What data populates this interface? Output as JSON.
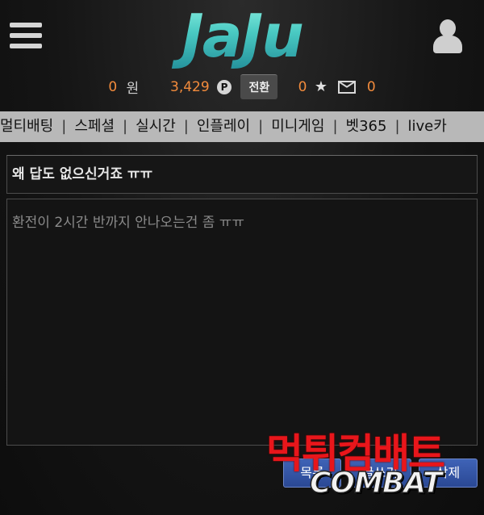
{
  "header": {
    "logo_text": "JaJu",
    "menu_icon": "hamburger-icon",
    "user_icon": "user-icon"
  },
  "balance": {
    "money": "0",
    "money_unit": "원",
    "points": "3,429",
    "points_badge": "P",
    "convert_label": "전환",
    "stars": "0",
    "star_glyph": "★",
    "messages": "0"
  },
  "nav": {
    "items": [
      "멀티배팅",
      "스페셜",
      "실시간",
      "인플레이",
      "미니게임",
      "벳365",
      "live카"
    ],
    "separator": "|"
  },
  "post": {
    "title": "왜 답도 없으신거죠 ㅠㅠ",
    "content": "환전이 2시간 반까지 안나오는건 좀 ㅠㅠ"
  },
  "buttons": {
    "list": "목록",
    "write": "글쓰기",
    "delete": "삭제"
  },
  "watermark": {
    "korean": "먹튀컴배트",
    "english": "COMBAT"
  },
  "colors": {
    "accent_orange": "#f28b3c",
    "logo_teal": "#49c9c2",
    "nav_bg": "#b8b8b8",
    "button_blue": "#3354a8",
    "watermark_red": "#e8161b"
  }
}
